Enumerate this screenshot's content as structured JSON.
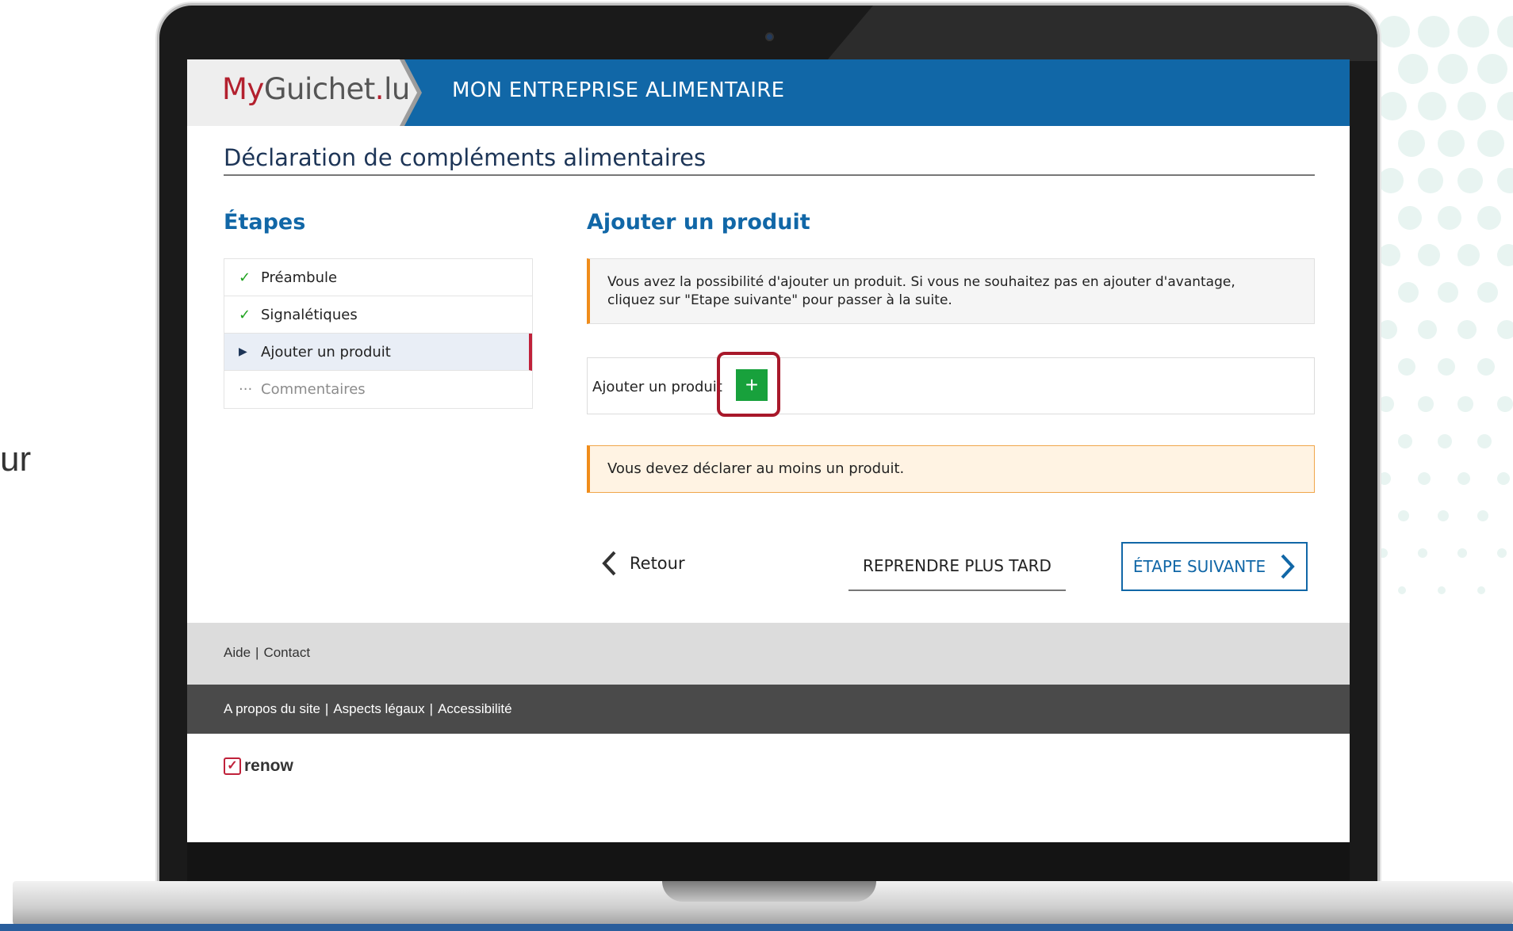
{
  "background": {
    "stray_text": "ur"
  },
  "header": {
    "brand_my": "My",
    "brand_guichet": "Guichet",
    "brand_dot": ".",
    "brand_lu": "lu",
    "title": "MON ENTREPRISE ALIMENTAIRE",
    "color": "#1167a7"
  },
  "page": {
    "title": "Déclaration de compléments alimentaires"
  },
  "steps": {
    "heading": "Étapes",
    "items": [
      {
        "label": "Préambule",
        "state": "done"
      },
      {
        "label": "Signalétiques",
        "state": "done"
      },
      {
        "label": "Ajouter un produit",
        "state": "active"
      },
      {
        "label": "Commentaires",
        "state": "todo"
      }
    ]
  },
  "main": {
    "heading": "Ajouter un produit",
    "info_line1": "Vous avez la possibilité d'ajouter un produit. Si vous ne souhaitez pas en ajouter d'avantage,",
    "info_line2": "cliquez sur \"Etape suivante\" pour passer à la suite.",
    "add_label": "Ajouter un produit",
    "add_button": "+",
    "warning": "Vous devez déclarer au moins un produit."
  },
  "nav": {
    "back": "Retour",
    "later": "REPRENDRE PLUS TARD",
    "next": "ÉTAPE SUIVANTE"
  },
  "footer": {
    "help": "Aide",
    "contact": "Contact",
    "about": "A propos du site",
    "legal": "Aspects légaux",
    "accessibility": "Accessibilité",
    "renow": "renow"
  },
  "colors": {
    "accent_orange": "#f08c1a",
    "highlight_red": "#a8182a",
    "add_green": "#18a13c"
  }
}
